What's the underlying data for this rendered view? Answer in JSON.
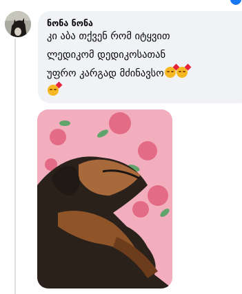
{
  "comment": {
    "author": "ნონა ნონა",
    "text_lines": [
      "კი აბა თქვენ რომ იტყვით",
      "ლედიკომ დედიკოსათან",
      "უფრო კარგად მძინავსო"
    ],
    "emoji": [
      "smiling-face-with-hearts-icon",
      "smiling-face-with-hearts-icon",
      "smiling-face-with-hearts-icon"
    ]
  },
  "photo": {
    "description_icon": "sleeping-dog-photo"
  }
}
